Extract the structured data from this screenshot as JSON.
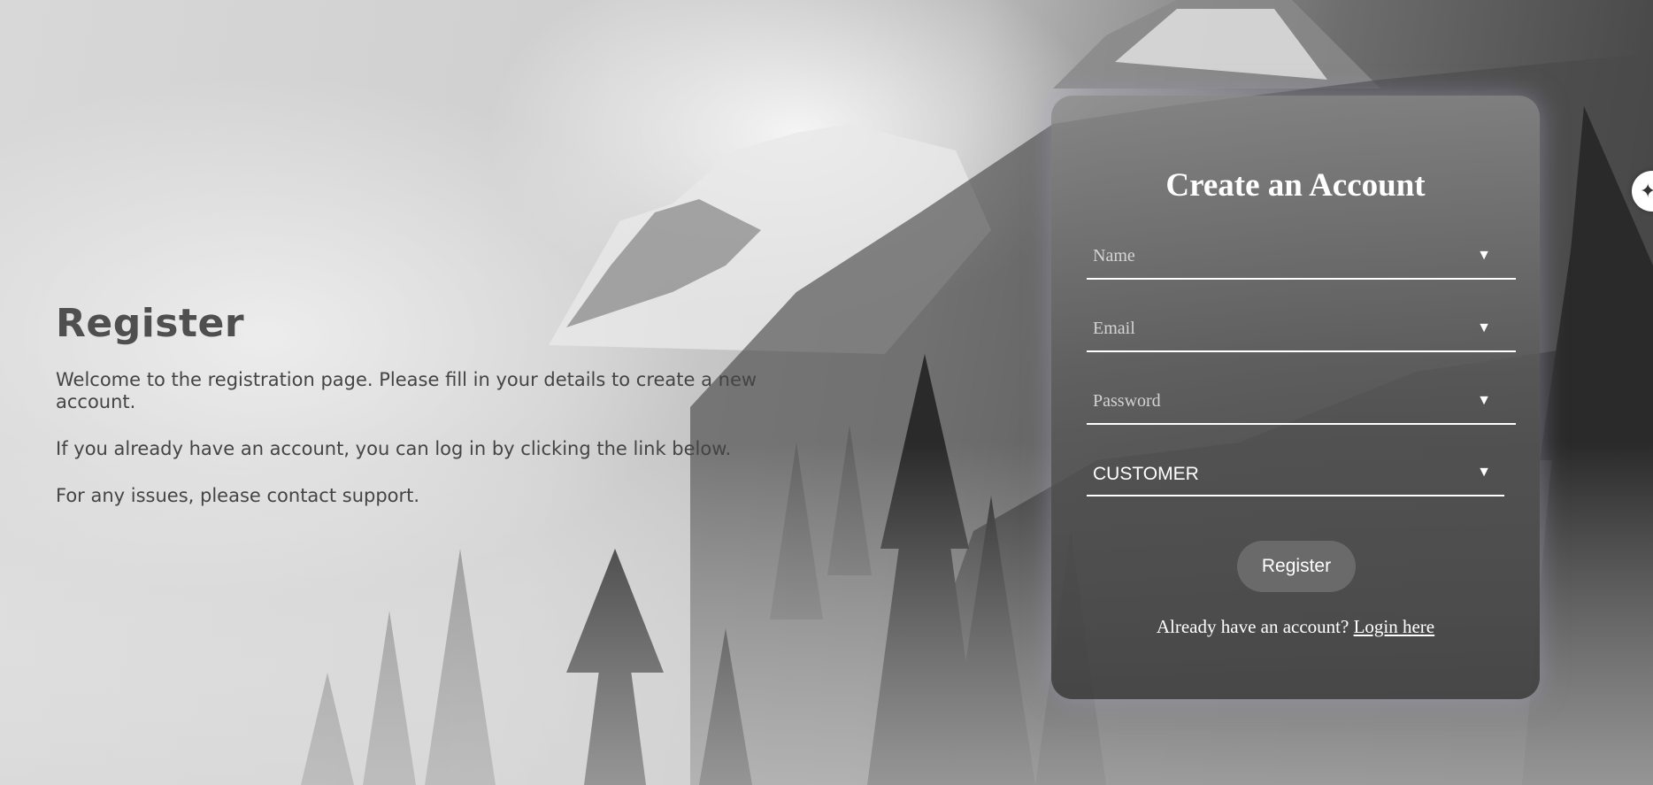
{
  "intro": {
    "title": "Register",
    "lines": [
      "Welcome to the registration page. Please fill in your details to create a new account.",
      "If you already have an account, you can log in by clicking the link below.",
      "For any issues, please contact support."
    ]
  },
  "form": {
    "title": "Create an Account",
    "fields": [
      {
        "placeholder": "Name",
        "icon": "chevron-down-icon"
      },
      {
        "placeholder": "Email",
        "icon": "chevron-down-icon"
      },
      {
        "placeholder": "Password",
        "icon": "chevron-down-icon"
      }
    ],
    "role_select": {
      "value": "CUSTOMER",
      "icon": "chevron-down-icon"
    },
    "register_label": "Register",
    "login_prompt": "Already have an account?",
    "login_link": "Login here"
  },
  "widget": {
    "icon": "sparkle-icon"
  },
  "colors": {
    "card_text": "#ffffff",
    "intro_text": "#4a4a4a"
  }
}
